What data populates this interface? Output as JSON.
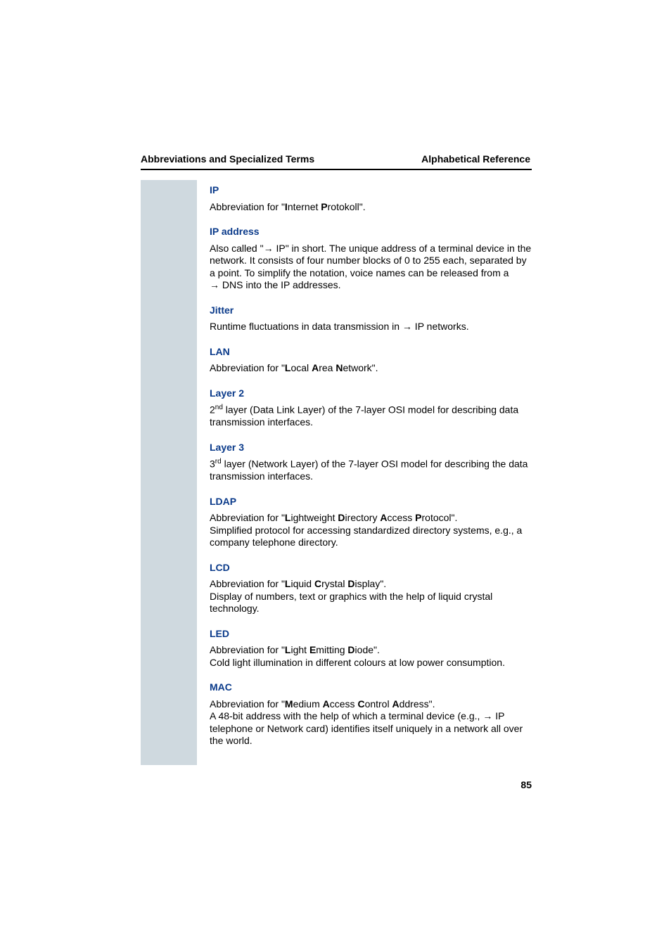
{
  "header": {
    "left": "Abbreviations and Specialized Terms",
    "right": "Alphabetical Reference"
  },
  "entries": {
    "ip": {
      "title": "IP",
      "def_pre": "Abbreviation for \"",
      "b1": "I",
      "after1": "nternet ",
      "b2": "P",
      "after2": "rotokoll\"."
    },
    "ip_address": {
      "title": "IP address",
      "def_pre": "Also called \"",
      "arrow": "→",
      "link": " IP",
      "def_rest": "\" in short. The unique address of a terminal device in the network. It consists of four number blocks of 0 to 255 each, separated by a point. To simplify the notation, voice names can be released from a ",
      "arrow2": "→",
      "link2": " DNS",
      "def_rest2": " into the IP addresses."
    },
    "jitter": {
      "title": "Jitter",
      "def_pre": "Runtime fluctuations in data transmission in ",
      "arrow": "→",
      "link": " IP",
      "def_rest": " networks."
    },
    "lan": {
      "title": "LAN",
      "def_pre": "Abbreviation for \"",
      "b1": "L",
      "after1": "ocal ",
      "b2": "A",
      "after2": "rea ",
      "b3": "N",
      "after3": "etwork\"."
    },
    "layer2": {
      "title": "Layer 2",
      "sup": "nd",
      "pre": "2",
      "def": " layer (Data Link Layer) of the 7-layer OSI model for describing data transmission interfaces."
    },
    "layer3": {
      "title": "Layer 3",
      "sup": "rd",
      "pre": "3",
      "def": " layer (Network Layer) of the 7-layer OSI model for describing the data transmission interfaces."
    },
    "ldap": {
      "title": "LDAP",
      "def_pre": "Abbreviation for \"",
      "b1": "L",
      "after1": "ightweight ",
      "b2": "D",
      "after2": "irectory ",
      "b3": "A",
      "after3": "ccess ",
      "b4": "P",
      "after4": "rotocol\".",
      "def2": "Simplified protocol for accessing standardized directory systems, e.g., a company telephone directory."
    },
    "lcd": {
      "title": "LCD",
      "def_pre": "Abbreviation for \"",
      "b1": "L",
      "after1": "iquid ",
      "b2": "C",
      "after2": "rystal ",
      "b3": "D",
      "after3": "isplay\".",
      "def2": "Display of numbers, text or graphics with the help of liquid crystal technology."
    },
    "led": {
      "title": "LED",
      "def_pre": "Abbreviation for \"",
      "b1": "L",
      "after1": "ight ",
      "b2": "E",
      "after2": "mitting ",
      "b3": "D",
      "after3": "iode\".",
      "def2": "Cold light illumination in different colours at low power consumption."
    },
    "mac": {
      "title": "MAC",
      "def_pre": "Abbreviation for \"",
      "b1": "M",
      "after1": "edium ",
      "b2": "A",
      "after2": "ccess ",
      "b3": "C",
      "after3": "ontrol ",
      "b4": "A",
      "after4": "ddress\".",
      "def2_pre": "A 48-bit address with the help of which a terminal device (e.g., ",
      "arrow": "→",
      "link": " IP",
      "def2_rest": " telephone or Network card) identifies itself uniquely in a network all over the world."
    }
  },
  "page_number": "85"
}
